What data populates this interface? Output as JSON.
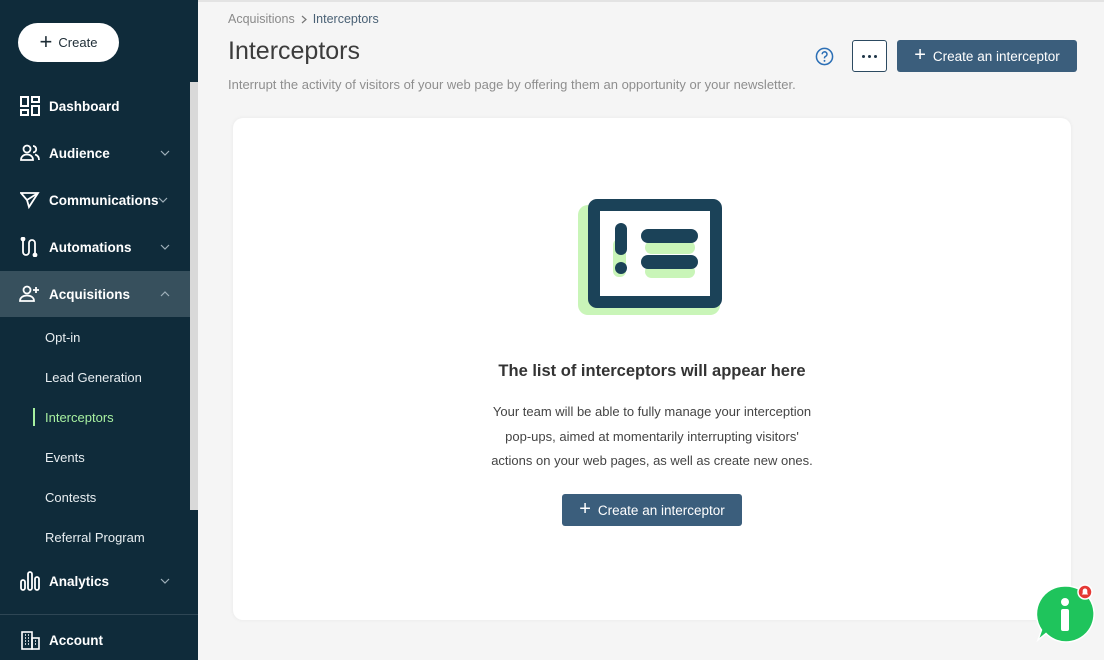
{
  "sidebar": {
    "create_label": "Create",
    "items": [
      {
        "label": "Dashboard",
        "icon": "dashboard-icon"
      },
      {
        "label": "Audience",
        "icon": "audience-icon"
      },
      {
        "label": "Communications",
        "icon": "send-icon"
      },
      {
        "label": "Automations",
        "icon": "automation-icon"
      },
      {
        "label": "Acquisitions",
        "icon": "add-user-icon"
      },
      {
        "label": "Analytics",
        "icon": "bar-chart-icon"
      },
      {
        "label": "Account",
        "icon": "building-icon"
      }
    ],
    "sub_items": [
      "Opt-in",
      "Lead Generation",
      "Interceptors",
      "Events",
      "Contests",
      "Referral Program"
    ],
    "active_sub": "Interceptors"
  },
  "breadcrumb": {
    "parent": "Acquisitions",
    "current": "Interceptors"
  },
  "header": {
    "title": "Interceptors",
    "subtitle": "Interrupt the activity of visitors of your web page by offering them an opportunity or your newsletter.",
    "create_label": "Create an interceptor"
  },
  "empty_state": {
    "title": "The list of interceptors will appear here",
    "description_lines": [
      "Your team will be able to fully manage your interception",
      "pop-ups, aimed at momentarily interrupting visitors'",
      "actions on your web pages, as well as create new ones."
    ],
    "button_label": "Create an interceptor"
  },
  "colors": {
    "sidebar_bg": "#0f2b3a",
    "accent_green": "#a7f0a0",
    "primary_button": "#3b5e7c",
    "chat_green": "#1fc45c",
    "notification_red": "#e53935"
  }
}
